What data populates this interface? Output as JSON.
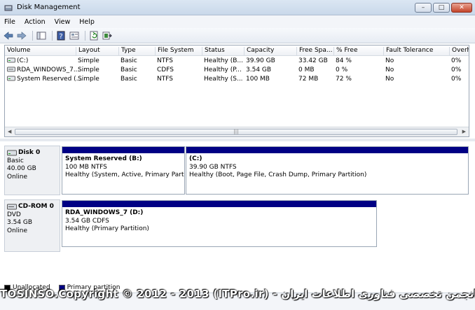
{
  "window": {
    "title": "Disk Management"
  },
  "menu": [
    "File",
    "Action",
    "View",
    "Help"
  ],
  "toolbar_icons": [
    "back-icon",
    "forward-icon",
    "console-tree-icon",
    "help-icon",
    "properties-icon",
    "refresh-icon",
    "export-list-icon"
  ],
  "volume_list": {
    "columns": [
      "Volume",
      "Layout",
      "Type",
      "File System",
      "Status",
      "Capacity",
      "Free Spa...",
      "% Free",
      "Fault Tolerance",
      "Overhe"
    ],
    "rows": [
      [
        "(C:)",
        "Simple",
        "Basic",
        "NTFS",
        "Healthy (B...",
        "39.90 GB",
        "33.42 GB",
        "84 %",
        "No",
        "0%"
      ],
      [
        "RDA_WINDOWS_7...",
        "Simple",
        "Basic",
        "CDFS",
        "Healthy (P...",
        "3.54 GB",
        "0 MB",
        "0 %",
        "No",
        "0%"
      ],
      [
        "System Reserved (...",
        "Simple",
        "Basic",
        "NTFS",
        "Healthy (S...",
        "100 MB",
        "72 MB",
        "72 %",
        "No",
        "0%"
      ]
    ]
  },
  "disks": [
    {
      "name": "Disk 0",
      "type": "Basic",
      "size": "40.00 GB",
      "status": "Online",
      "partitions": [
        {
          "title": "System Reserved  (B:)",
          "size_fs": "100 MB NTFS",
          "status": "Healthy (System, Active, Primary Partitio"
        },
        {
          "title": "(C:)",
          "size_fs": "39.90 GB NTFS",
          "status": "Healthy (Boot, Page File, Crash Dump, Primary Partition)"
        }
      ]
    },
    {
      "name": "CD-ROM 0",
      "type": "DVD",
      "size": "3.54 GB",
      "status": "Online",
      "partitions": [
        {
          "title": "RDA_WINDOWS_7  (D:)",
          "size_fs": "3.54 GB CDFS",
          "status": "Healthy (Primary Partition)"
        }
      ]
    }
  ],
  "legend": {
    "unallocated": "Unallocated",
    "primary": "Primary partition",
    "unallocated_color": "#000000",
    "primary_color": "#000084"
  },
  "watermark": "TOSINSO.Copyright © 2012 - 2013 (ITPro.ir) - انجمن تخصصی فناوری اطلاعات ایران"
}
